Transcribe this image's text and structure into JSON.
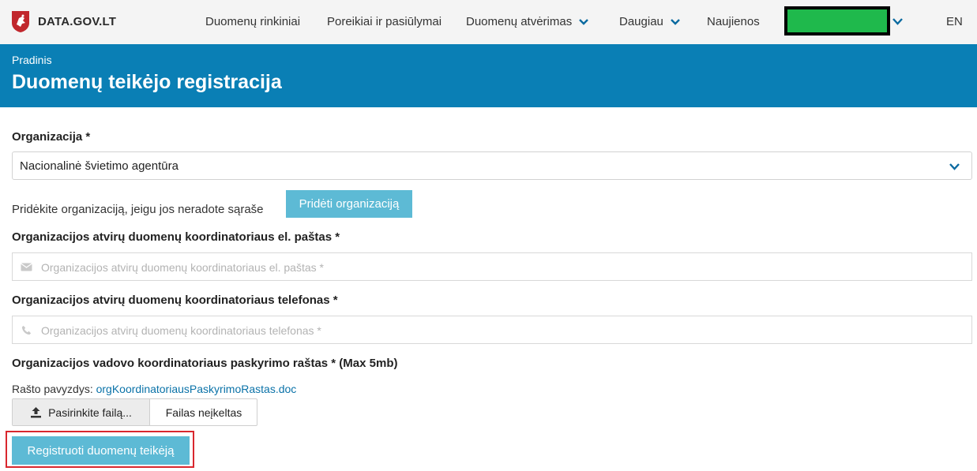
{
  "nav": {
    "brand": "DATA.GOV.LT",
    "items": [
      {
        "label": "Duomenų rinkiniai"
      },
      {
        "label": "Poreikiai ir pasiūlymai"
      },
      {
        "label": "Duomenų atvėrimas"
      },
      {
        "label": "Daugiau"
      },
      {
        "label": "Naujienos"
      }
    ],
    "lang": "EN"
  },
  "header": {
    "breadcrumb": "Pradinis",
    "title": "Duomenų teikėjo registracija"
  },
  "form": {
    "organization": {
      "label": "Organizacija *",
      "selected": "Nacionalinė švietimo agentūra"
    },
    "add_org": {
      "helper": "Pridėkite organizaciją, jeigu jos neradote sąraše",
      "button": "Pridėti organizaciją"
    },
    "email": {
      "label": "Organizacijos atvirų duomenų koordinatoriaus el. paštas *",
      "placeholder": "Organizacijos atvirų duomenų koordinatoriaus el. paštas *"
    },
    "phone": {
      "label": "Organizacijos atvirų duomenų koordinatoriaus telefonas *",
      "placeholder": "Organizacijos atvirų duomenų koordinatoriaus telefonas *"
    },
    "appointment": {
      "label": "Organizacijos vadovo koordinatoriaus paskyrimo raštas * (Max 5mb)",
      "sample_prefix": "Rašto pavyzdys:",
      "sample_link": "orgKoordinatoriausPaskyrimoRastas.doc",
      "choose_button": "Pasirinkite failą...",
      "file_status": "Failas neįkeltas"
    },
    "submit": "Registruoti duomenų teikėją"
  },
  "colors": {
    "header_band": "#0a7fb5",
    "button": "#5dbad5",
    "link": "#0a72a8",
    "highlight": "#d9272e"
  }
}
